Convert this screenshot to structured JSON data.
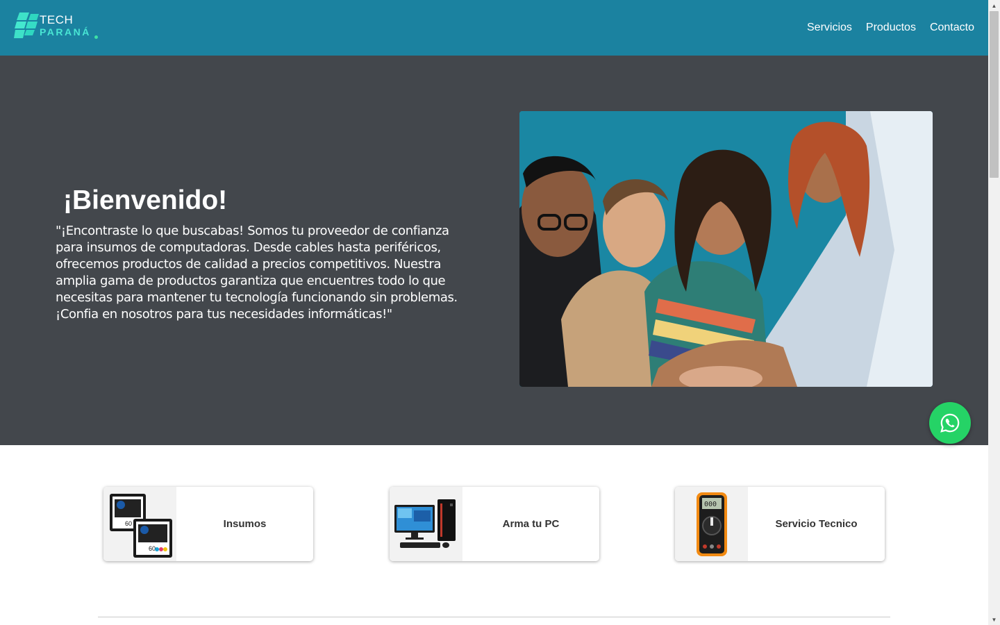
{
  "brand": {
    "name_top": "TECH",
    "name_bottom": "PARANÁ",
    "color_primary": "#1b82a0",
    "color_accent": "#49e6d4"
  },
  "nav": {
    "items": [
      {
        "label": "Servicios"
      },
      {
        "label": "Productos"
      },
      {
        "label": "Contacto"
      }
    ]
  },
  "hero": {
    "title": "¡Bienvenido!",
    "text": "\"¡Encontraste lo que buscabas! Somos tu proveedor de confianza para insumos de computadoras. Desde cables hasta periféricos, ofrecemos productos de calidad a precios competitivos. Nuestra amplia gama de productos garantiza que encuentres todo lo que necesitas para mantener tu tecnología funcionando sin problemas. ¡Confia en nosotros para tus necesidades informáticas!\"",
    "image": "group-of-smiling-people-photo",
    "background": "#43474c"
  },
  "whatsapp": {
    "icon": "whatsapp-icon",
    "color": "#25d366"
  },
  "cards": [
    {
      "label": "Insumos",
      "icon": "ink-cartridge-icon"
    },
    {
      "label": "Arma tu PC",
      "icon": "desktop-pc-icon"
    },
    {
      "label": "Servicio Tecnico",
      "icon": "multimeter-icon"
    }
  ]
}
